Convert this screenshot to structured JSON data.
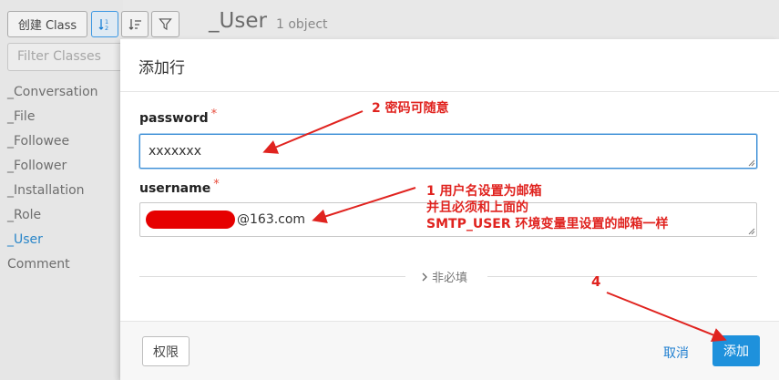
{
  "sidebar": {
    "create_button": "创建 Class",
    "sort_asc_icon": "sort-ascending-icon",
    "sort_desc_icon": "sort-descending-icon",
    "filter_icon": "filter-icon",
    "filter_placeholder": "Filter Classes",
    "classes": [
      "_Conversation",
      "_File",
      "_Followee",
      "_Follower",
      "_Installation",
      "_Role",
      "_User",
      "Comment"
    ],
    "active_class": "_User"
  },
  "main": {
    "title": "_User",
    "count": "1 object"
  },
  "modal": {
    "title": "添加行",
    "fields": [
      {
        "label": "password",
        "required_mark": "*",
        "value": "xxxxxxx"
      },
      {
        "label": "username",
        "required_mark": "*",
        "value_suffix": "@163.com"
      }
    ],
    "optional_label": "非必填",
    "permissions_button": "权限",
    "cancel_button": "取消",
    "add_button": "添加"
  },
  "annotations": {
    "note_2": "2 密码可随意",
    "note_1_line1": "1 用户名设置为邮箱",
    "note_1_line2": "并且必须和上面的",
    "note_1_line3": "SMTP_USER 环境变量里设置的邮箱一样",
    "note_4": "4"
  },
  "colors": {
    "accent": "#1e91dc",
    "annotation_red": "#e0231f",
    "active_link": "#2a86c9"
  }
}
